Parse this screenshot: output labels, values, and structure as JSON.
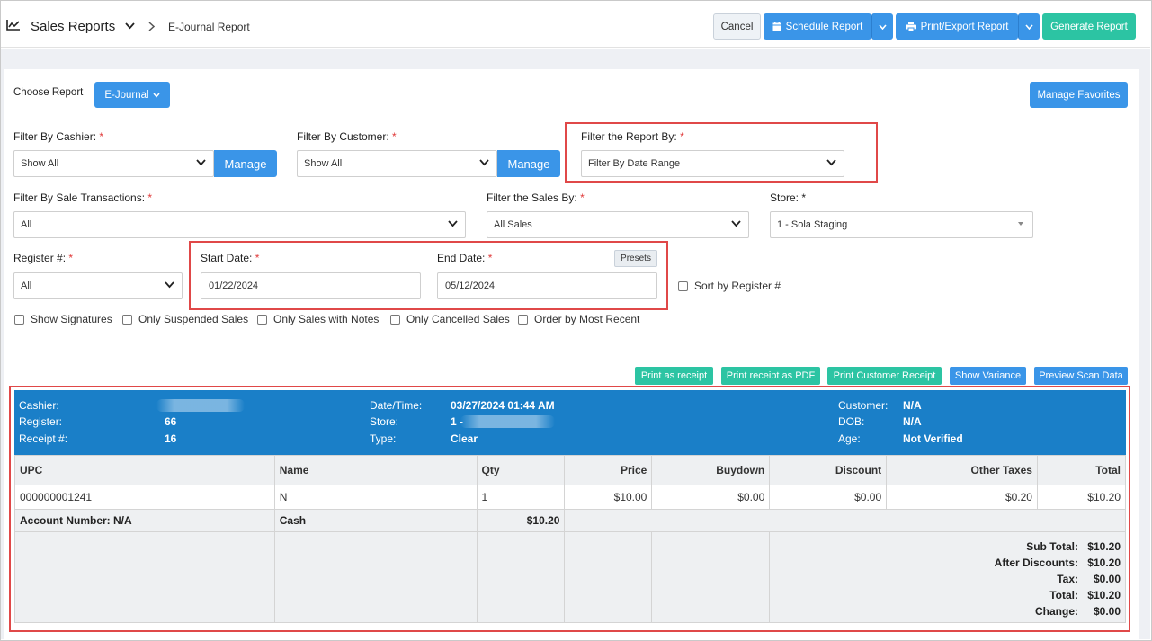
{
  "header": {
    "app_title": "Sales Reports",
    "breadcrumb": "E-Journal Report",
    "cancel_label": "Cancel",
    "schedule_label": "Schedule Report",
    "print_label": "Print/Export Report",
    "generate_label": "Generate Report"
  },
  "choose": {
    "label": "Choose Report",
    "report_value": "E-Journal",
    "favorites_label": "Manage Favorites"
  },
  "filters": {
    "cashier": {
      "label": "Filter By Cashier:",
      "value": "Show All",
      "manage": "Manage"
    },
    "customer": {
      "label": "Filter By Customer:",
      "value": "Show All",
      "manage": "Manage"
    },
    "report_by": {
      "label": "Filter the Report By:",
      "value": "Filter By Date Range"
    },
    "sale_transactions": {
      "label": "Filter By Sale Transactions:",
      "value": "All"
    },
    "sales_by": {
      "label": "Filter the Sales By:",
      "value": "All Sales"
    },
    "store": {
      "label": "Store:",
      "value": "1 - Sola Staging"
    },
    "register": {
      "label": "Register #:",
      "value": "All"
    },
    "start_date": {
      "label": "Start Date:",
      "value": "01/22/2024"
    },
    "end_date": {
      "label": "End Date:",
      "value": "05/12/2024"
    },
    "presets": "Presets",
    "sort_by_register": "Sort by Register #",
    "required_mark": "*"
  },
  "options": {
    "show_signatures": "Show Signatures",
    "only_suspended": "Only Suspended Sales",
    "only_notes": "Only Sales with Notes",
    "only_cancelled": "Only Cancelled Sales",
    "order_recent": "Order by Most Recent"
  },
  "actions": {
    "print_receipt": "Print as receipt",
    "print_pdf": "Print receipt as PDF",
    "print_customer": "Print Customer Receipt",
    "show_variance": "Show Variance",
    "preview_scan": "Preview Scan Data"
  },
  "receipt": {
    "cashier_label": "Cashier:",
    "register_label": "Register:",
    "register_value": "66",
    "receipt_label": "Receipt #:",
    "receipt_value": "16",
    "datetime_label": "Date/Time:",
    "datetime_value": "03/27/2024 01:44 AM",
    "store_label": "Store:",
    "store_value": "1 -",
    "type_label": "Type:",
    "type_value": "Clear",
    "customer_label": "Customer:",
    "customer_value": "N/A",
    "dob_label": "DOB:",
    "dob_value": "N/A",
    "age_label": "Age:",
    "age_value": "Not Verified",
    "columns": [
      "UPC",
      "Name",
      "Qty",
      "Price",
      "Buydown",
      "Discount",
      "Other Taxes",
      "Total"
    ],
    "item": {
      "upc": "000000001241",
      "name": "N",
      "qty": "1",
      "price": "$10.00",
      "buydown": "$0.00",
      "discount": "$0.00",
      "other_taxes": "$0.20",
      "total": "$10.20"
    },
    "payment": {
      "account": "Account Number: N/A",
      "method": "Cash",
      "amount": "$10.20"
    },
    "totals": {
      "subtotal_label": "Sub Total:",
      "subtotal": "$10.20",
      "after_discounts_label": "After Discounts:",
      "after_discounts": "$10.20",
      "tax_label": "Tax:",
      "tax": "$0.00",
      "total_label": "Total:",
      "total": "$10.20",
      "change_label": "Change:",
      "change": "$0.00"
    }
  }
}
